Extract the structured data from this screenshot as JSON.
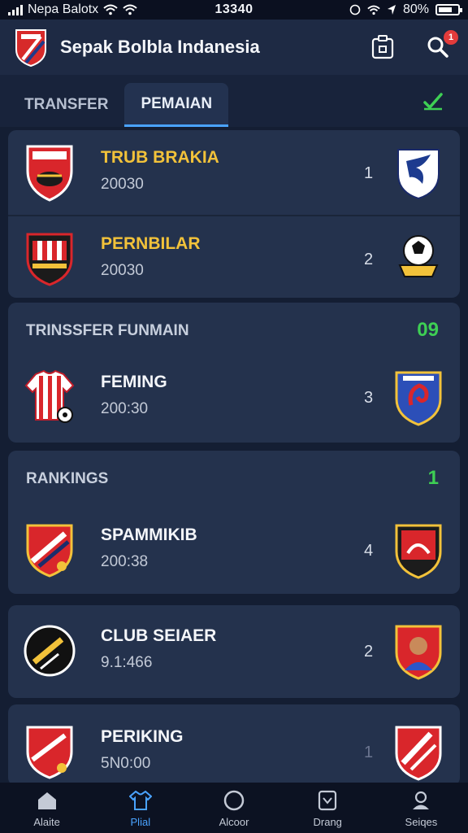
{
  "status_bar": {
    "carrier": "Nepa Balotx",
    "time": "13340",
    "battery": "80%"
  },
  "app_bar": {
    "title": "Sepak Bolbla Indanesia",
    "notification_count": "1"
  },
  "tabs": [
    {
      "label": "TRANSFER",
      "active": false
    },
    {
      "label": "PEMAIAN",
      "active": true
    }
  ],
  "card1": {
    "rows": [
      {
        "name": "TRUB BRAKIA",
        "time": "20030",
        "rank": "1",
        "name_color": "gold",
        "time_color": "grey"
      },
      {
        "name": "PERNBILAR",
        "time": "20030",
        "rank": "2",
        "name_color": "gold",
        "time_color": "grey"
      }
    ]
  },
  "card2": {
    "header": "TRINSSFER FUNMAIN",
    "badge": "09",
    "rows": [
      {
        "name": "FEMING",
        "time": "200:30",
        "rank": "3"
      }
    ]
  },
  "card3": {
    "header": "RANKINGS",
    "badge": "1",
    "rows": [
      {
        "name": "SPAMMIKIB",
        "time": "200:38",
        "rank": "4"
      }
    ]
  },
  "card4": {
    "rows": [
      {
        "name": "CLUB SEIAER",
        "time": "9.1:466",
        "rank": "2"
      }
    ]
  },
  "card5": {
    "rows": [
      {
        "name": "PERIKING",
        "time": "5N0:00",
        "rank": "1"
      }
    ]
  },
  "bottom_nav": [
    {
      "label": "Alaite",
      "icon": "home-icon",
      "active": false
    },
    {
      "label": "Plial",
      "icon": "shirt-icon",
      "active": true
    },
    {
      "label": "Alcoor",
      "icon": "ball-icon",
      "active": false
    },
    {
      "label": "Drang",
      "icon": "trophy-icon",
      "active": false
    },
    {
      "label": "Seiqes",
      "icon": "profile-icon",
      "active": false
    }
  ],
  "colors": {
    "background": "#141e33",
    "card": "#24324d",
    "accent": "#4aa3ff",
    "gold": "#f2c23a",
    "green": "#4ed34f"
  }
}
